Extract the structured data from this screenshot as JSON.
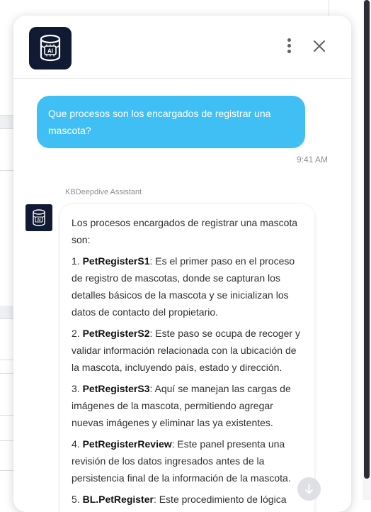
{
  "header": {
    "logo_icon": "database-ai-icon",
    "menu_icon": "more-vertical-icon",
    "close_icon": "close-icon"
  },
  "messages": {
    "user": {
      "text": "Que procesos son los encargados de registrar una mascota?",
      "time": "9:41 AM"
    },
    "bot": {
      "name": "KBDeepdive Assistant",
      "intro": "Los procesos encargados de registrar una mascota son:",
      "items": [
        {
          "num": "1. ",
          "title": "PetRegisterS1",
          "text": ": Es el primer paso en el proceso de registro de mascotas, donde se capturan los detalles básicos de la mascota y se inicializan los datos de contacto del propietario."
        },
        {
          "num": "2. ",
          "title": "PetRegisterS2",
          "text": ": Este paso se ocupa de recoger y validar información relacionada con la ubicación de la mascota, incluyendo país, estado y dirección."
        },
        {
          "num": "3. ",
          "title": "PetRegisterS3",
          "text": ": Aquí se manejan las cargas de imágenes de la mascota, permitiendo agregar nuevas imágenes y eliminar las ya existentes."
        },
        {
          "num": "4. ",
          "title": "PetRegisterReview",
          "text": ": Este panel presenta una revisión de los datos ingresados antes de la persistencia final de la información de la mascota."
        },
        {
          "num": "5. ",
          "title": "BL.PetRegister",
          "text": ": Este procedimiento de lógica"
        }
      ]
    }
  },
  "scroll_icon": "arrow-down-icon",
  "colors": {
    "accent": "#40bff5",
    "brand_dark": "#101a33"
  }
}
